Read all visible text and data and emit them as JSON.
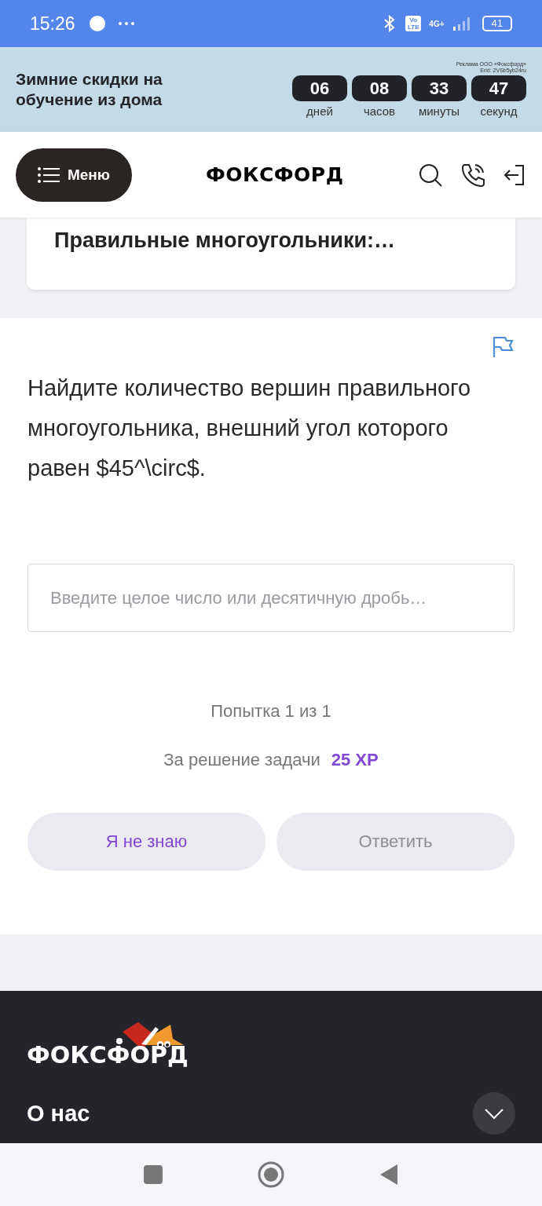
{
  "status_bar": {
    "time": "15:26",
    "volte": "Vo LTE",
    "network": "4G+",
    "battery": "41"
  },
  "ad_banner": {
    "title": "Зимние скидки на обучение из дома",
    "disclaimer": [
      "Реклама ООО «Фоксфорд»",
      "Erid: 2VSb5yb24ru"
    ],
    "countdown": [
      {
        "value": "06",
        "label": "дней"
      },
      {
        "value": "08",
        "label": "часов"
      },
      {
        "value": "33",
        "label": "минуты"
      },
      {
        "value": "47",
        "label": "секунд"
      }
    ]
  },
  "header": {
    "menu_button": "Меню",
    "logo": "ФОКСФОРД"
  },
  "lesson_card": {
    "title": "Правильные многоугольники:…"
  },
  "task": {
    "question": "Найдите количество вершин правильного многоугольника, внешний угол которого равен $45^\\circ$.",
    "answer_field": {
      "placeholder": "Введите целое число или десятичную дробь…"
    },
    "attempts": "Попытка 1 из 1",
    "reward_label": "За решение задачи",
    "reward_value": "25 XP",
    "buttons": [
      {
        "label": "Я не знаю",
        "disabled": false
      },
      {
        "label": "Ответить",
        "disabled": true
      }
    ]
  },
  "footer": {
    "logo": "ФОКСФОРД",
    "section": "О нас",
    "expanded": false
  }
}
